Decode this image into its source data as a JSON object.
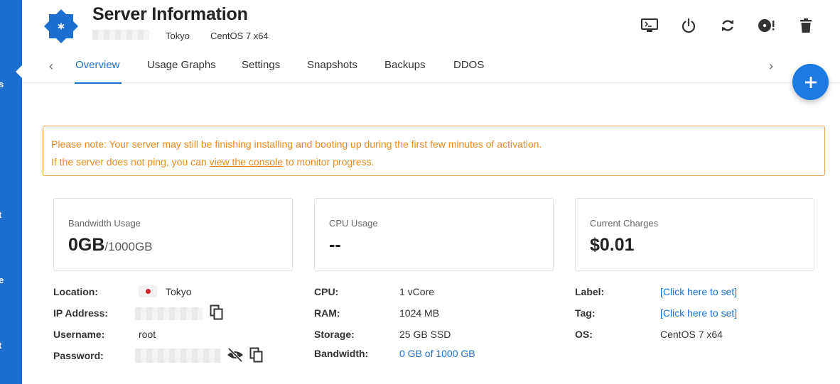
{
  "header": {
    "title": "Server Information",
    "location": "Tokyo",
    "os": "CentOS 7 x64"
  },
  "actions": [
    {
      "name": "console-icon"
    },
    {
      "name": "power-icon"
    },
    {
      "name": "restart-icon"
    },
    {
      "name": "reinstall-icon"
    },
    {
      "name": "delete-icon"
    }
  ],
  "tabs": [
    "Overview",
    "Usage Graphs",
    "Settings",
    "Snapshots",
    "Backups",
    "DDOS"
  ],
  "notice": {
    "line1": "Please note: Your server may still be finishing installing and booting up during the first few minutes of activation.",
    "line2_before": "If the server does not ping, you can ",
    "line2_link": "view the console",
    "line2_after": " to monitor progress."
  },
  "cards": {
    "bandwidth": {
      "label": "Bandwidth Usage",
      "value": "0GB",
      "suffix": "/1000GB"
    },
    "cpu": {
      "label": "CPU Usage",
      "value": "--"
    },
    "charges": {
      "label": "Current Charges",
      "value": "$0.01"
    }
  },
  "details": {
    "location_label": "Location:",
    "location_value": "Tokyo",
    "ip_label": "IP Address:",
    "username_label": "Username:",
    "username_value": "root",
    "password_label": "Password:",
    "cpu_label": "CPU:",
    "cpu_value": "1 vCore",
    "ram_label": "RAM:",
    "ram_value": "1024 MB",
    "storage_label": "Storage:",
    "storage_value": "25 GB SSD",
    "bandwidth_label": "Bandwidth:",
    "bandwidth_value": "0 GB of 1000 GB",
    "label_label": "Label:",
    "label_value": "[Click here to set]",
    "tag_label": "Tag:",
    "tag_value": "[Click here to set]",
    "os_label": "OS:",
    "os_value": "CentOS 7 x64"
  },
  "colors": {
    "accent": "#1c6fd0",
    "warning": "#e98a1e",
    "sidebar": "#1c6fd0"
  }
}
